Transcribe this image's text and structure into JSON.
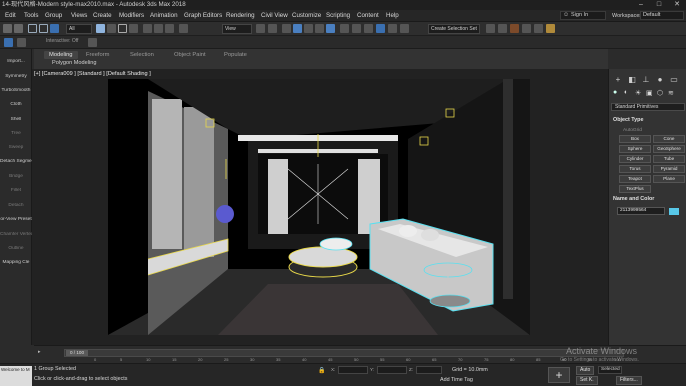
{
  "window": {
    "title": "14-现代风格-Modern style-max2010.max - Autodesk 3ds Max 2018",
    "minimize": "–",
    "maximize": "□",
    "close": "✕"
  },
  "menubar": {
    "items": [
      "Edit",
      "Tools",
      "Group",
      "Views",
      "Create",
      "Modifiers",
      "Animation",
      "Graph Editors",
      "Rendering",
      "Civil View",
      "Customize",
      "Scripting",
      "Content",
      "Help"
    ],
    "sign_in": "Sign In",
    "workspaces_label": "Workspaces:",
    "workspace_value": "Default"
  },
  "toolbar": {
    "filter_value": "All",
    "view_value": "View",
    "selection_set": "Create Selection Set"
  },
  "toolbar2": {
    "layer_label": "Interactive: Off"
  },
  "ribbon": {
    "tabs": [
      "Modeling",
      "Freeform",
      "Selection",
      "Object Paint",
      "Populate"
    ],
    "active_tab": "Modeling",
    "sub_label": "Polygon Modeling"
  },
  "left_panel": {
    "items": [
      {
        "label": "Import...",
        "dim": false
      },
      {
        "label": "Symmetry",
        "dim": false
      },
      {
        "label": "TurboSmooth",
        "dim": false
      },
      {
        "label": "Cloth",
        "dim": false
      },
      {
        "label": "Shell",
        "dim": false
      },
      {
        "label": "Tree",
        "dim": true
      },
      {
        "label": "Sweep",
        "dim": true
      },
      {
        "label": "Detach Segments",
        "dim": false
      },
      {
        "label": "Bridge",
        "dim": true
      },
      {
        "label": "Fillet",
        "dim": true
      },
      {
        "label": "Detach",
        "dim": true
      },
      {
        "label": "or-View Preset",
        "dim": false
      },
      {
        "label": "Chamfer Vertex",
        "dim": true
      },
      {
        "label": "Outline",
        "dim": true
      },
      {
        "label": "Mapping Cle",
        "dim": false
      }
    ]
  },
  "viewport": {
    "label": "[+] [Camera009 ] [Standard ] [Default Shading ]"
  },
  "command_panel": {
    "category": "Standard Primitives",
    "object_type_header": "Object Type",
    "autogrid_label": "AutoGrid",
    "primitives": [
      "Box",
      "Cone",
      "Sphere",
      "GeoSphere",
      "Cylinder",
      "Tube",
      "Torus",
      "Pyramid",
      "Teapot",
      "Plane",
      "TextPlus"
    ],
    "name_color_header": "Name and Color",
    "object_name": "2113999564",
    "wire_color": "#58c8e8"
  },
  "timeline": {
    "frame_display": "0 / 100",
    "tick_labels": [
      "0",
      "5",
      "10",
      "15",
      "20",
      "25",
      "30",
      "35",
      "40",
      "45",
      "50",
      "55",
      "60",
      "65",
      "70",
      "75",
      "80",
      "85",
      "90",
      "95",
      "100"
    ]
  },
  "statusbar": {
    "script_hint": "Welcome to M",
    "selection_status": "1 Group Selected",
    "prompt": "Click or click-and-drag to select objects",
    "x_value": "",
    "y_value": "",
    "z_value": "",
    "grid_value": "Grid = 10.0mm",
    "add_time_tag": "Add Time Tag",
    "auto_key": "Auto",
    "set_key": "Set K.",
    "selected_value": "Selected",
    "filters": "Filters..."
  },
  "watermark": {
    "title": "Activate Windows",
    "subtitle": "Go to Settings to activate Windows."
  }
}
